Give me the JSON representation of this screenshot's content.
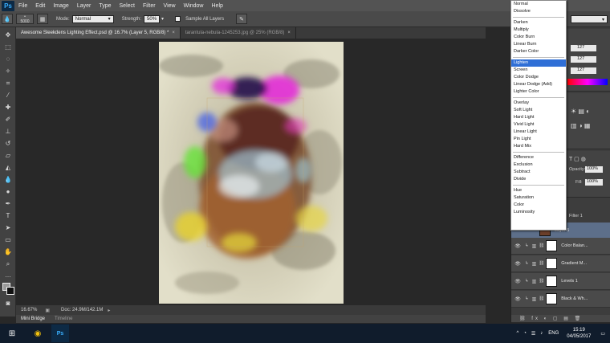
{
  "menubar": {
    "logo": "Ps",
    "items": [
      "File",
      "Edit",
      "Image",
      "Layer",
      "Type",
      "Select",
      "Filter",
      "View",
      "Window",
      "Help"
    ]
  },
  "options": {
    "brush_size": "5000",
    "mode_label": "Mode:",
    "mode_value": "Normal",
    "strength_label": "Strength:",
    "strength_value": "50%",
    "sample_all_label": "Sample All Layers"
  },
  "tabs": [
    {
      "label": "Awesome Sleekdens Lighting Effect.psd @ 16.7% (Layer 5, RGB/8) *",
      "active": true
    },
    {
      "label": "tarantula-nebula-1245253.jpg @ 25% (RGB/8)",
      "active": false
    }
  ],
  "status": {
    "zoom": "16.67%",
    "doc": "Doc: 24.9M/142.1M"
  },
  "bottom_tabs": [
    "Mini Bridge",
    "Timeline"
  ],
  "panels": {
    "color_values": [
      "127",
      "127",
      "127"
    ],
    "opacity_label": "Opacity:",
    "opacity_value": "100%",
    "fill_label": "Fill:",
    "fill_value": "100%",
    "smart_filter_label": "Filter 1",
    "layers": [
      {
        "name": "Layer 5",
        "selected": true
      },
      {
        "name": "Color Balan...",
        "selected": false
      },
      {
        "name": "Gradient M...",
        "selected": false
      },
      {
        "name": "Levels 1",
        "selected": false
      },
      {
        "name": "Black & Wh...",
        "selected": false
      }
    ]
  },
  "blend_modes": {
    "groups": [
      [
        "Normal",
        "Dissolve"
      ],
      [
        "Darken",
        "Multiply",
        "Color Burn",
        "Linear Burn",
        "Darker Color"
      ],
      [
        "Lighten",
        "Screen",
        "Color Dodge",
        "Linear Dodge (Add)",
        "Lighter Color"
      ],
      [
        "Overlay",
        "Soft Light",
        "Hard Light",
        "Vivid Light",
        "Linear Light",
        "Pin Light",
        "Hard Mix"
      ],
      [
        "Difference",
        "Exclusion",
        "Subtract",
        "Divide"
      ],
      [
        "Hue",
        "Saturation",
        "Color",
        "Luminosity"
      ]
    ],
    "selected": "Lighten"
  },
  "taskbar": {
    "lang": "ENG",
    "time": "15:19",
    "date": "04/05/2017"
  },
  "colors": {
    "menubar": "#535353",
    "workspace": "#282828",
    "selection": "#2f6fd6",
    "taskbar": "#101c2c"
  }
}
